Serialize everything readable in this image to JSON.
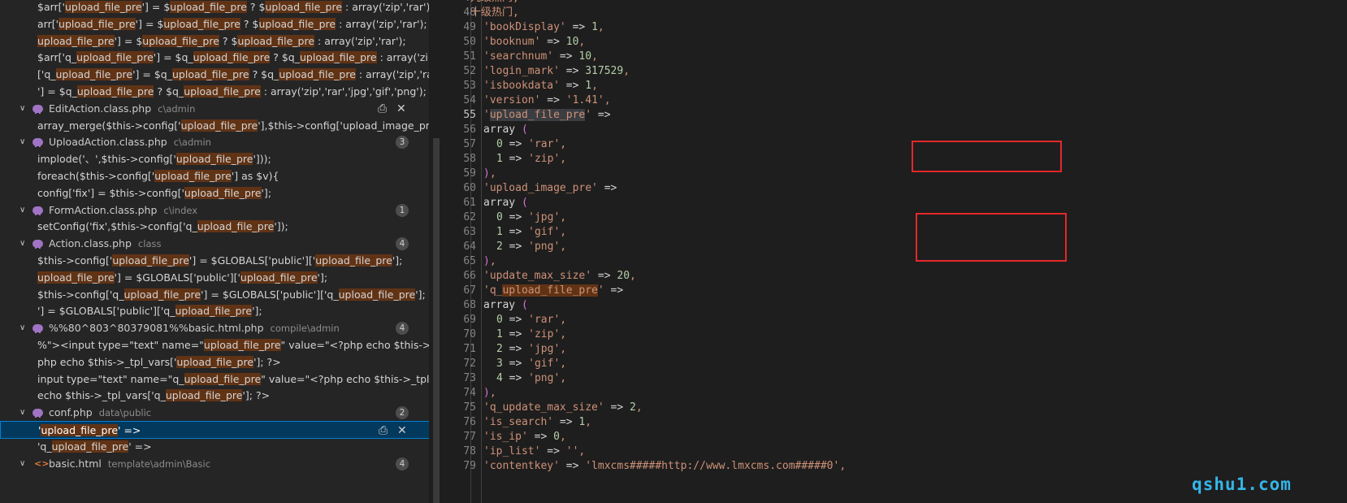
{
  "search_results": [
    {
      "type": "match",
      "text": "$arr['upload_file_pre'] = $upload_file_pre ? $upload_file_pre : array('zip','rar');"
    },
    {
      "type": "match",
      "text": "arr['upload_file_pre'] = $upload_file_pre ? $upload_file_pre : array('zip','rar');"
    },
    {
      "type": "match",
      "text": "upload_file_pre'] = $upload_file_pre ? $upload_file_pre : array('zip','rar');"
    },
    {
      "type": "match",
      "text": "$arr['q_upload_file_pre'] = $q_upload_file_pre ? $q_upload_file_pre : array('zip','rar','jp..."
    },
    {
      "type": "match",
      "text": "['q_upload_file_pre'] = $q_upload_file_pre ? $q_upload_file_pre : array('zip','rar','jpg','g..."
    },
    {
      "type": "match",
      "text": "'] = $q_upload_file_pre ? $q_upload_file_pre : array('zip','rar','jpg','gif','png');"
    },
    {
      "type": "file",
      "name": "EditAction.class.php",
      "path": "c\\admin",
      "badge": "",
      "icon": "php-icon"
    },
    {
      "type": "match",
      "text": "array_merge($this->config['upload_file_pre'],$this->config['upload_image_pre']);"
    },
    {
      "type": "file",
      "name": "UploadAction.class.php",
      "path": "c\\admin",
      "badge": "3",
      "icon": "php-icon"
    },
    {
      "type": "match",
      "text": "implode('、',$this->config['upload_file_pre']));"
    },
    {
      "type": "match",
      "text": "foreach($this->config['upload_file_pre'] as $v){"
    },
    {
      "type": "match",
      "text": "config['fix'] = $this->config['upload_file_pre'];"
    },
    {
      "type": "file",
      "name": "FormAction.class.php",
      "path": "c\\index",
      "badge": "1",
      "icon": "php-icon"
    },
    {
      "type": "match",
      "text": "setConfig('fix',$this->config['q_upload_file_pre']);"
    },
    {
      "type": "file",
      "name": "Action.class.php",
      "path": "class",
      "badge": "4",
      "icon": "php-icon"
    },
    {
      "type": "match",
      "text": "$this->config['upload_file_pre'] = $GLOBALS['public']['upload_file_pre'];"
    },
    {
      "type": "match",
      "text": "upload_file_pre'] = $GLOBALS['public']['upload_file_pre'];"
    },
    {
      "type": "match",
      "text": "$this->config['q_upload_file_pre'] = $GLOBALS['public']['q_upload_file_pre'];"
    },
    {
      "type": "match",
      "text": "'] = $GLOBALS['public']['q_upload_file_pre'];"
    },
    {
      "type": "file",
      "name": "%%80^803^80379081%%basic.html.php",
      "path": "compile\\admin",
      "badge": "4",
      "icon": "php-icon"
    },
    {
      "type": "match",
      "text": "%\">​<input type=\"text\" name=\"upload_file_pre\" value=\"<?php echo $this->_tpl_vars..."
    },
    {
      "type": "match",
      "text": "php echo $this->_tpl_vars['upload_file_pre']; ?>"
    },
    {
      "type": "match",
      "text": "input type=\"text\" name=\"q_upload_file_pre\" value=\"<?php echo $this->_tpl_vars['q_..."
    },
    {
      "type": "match",
      "text": "echo $this->_tpl_vars['q_upload_file_pre']; ?>"
    },
    {
      "type": "file",
      "name": "conf.php",
      "path": "data\\public",
      "badge": "2",
      "icon": "php-icon"
    },
    {
      "type": "match",
      "text": "'upload_file_pre' =>",
      "selected": true
    },
    {
      "type": "match",
      "text": "'q_upload_file_pre' =>"
    },
    {
      "type": "file",
      "name": "basic.html",
      "path": "template\\admin\\Basic",
      "badge": "4",
      "icon": "html-icon"
    }
  ],
  "code_lines": [
    {
      "n": "47",
      "t": "九级热门',"
    },
    {
      "n": "48",
      "t": "十级热门',"
    },
    {
      "n": "49",
      "t": "'bookDisplay' => 1,"
    },
    {
      "n": "50",
      "t": "'booknum' => 10,"
    },
    {
      "n": "51",
      "t": "'searchnum' => 10,"
    },
    {
      "n": "52",
      "t": "'login_mark' => 317529,"
    },
    {
      "n": "53",
      "t": "'isbookdata' => 1,"
    },
    {
      "n": "54",
      "t": "'version' => '1.41',"
    },
    {
      "n": "55",
      "t": "'upload_file_pre' =>"
    },
    {
      "n": "56",
      "t": "array ("
    },
    {
      "n": "57",
      "t": "0 => 'rar',"
    },
    {
      "n": "58",
      "t": "1 => 'zip',"
    },
    {
      "n": "59",
      "t": "),"
    },
    {
      "n": "60",
      "t": "'upload_image_pre' =>"
    },
    {
      "n": "61",
      "t": "array ("
    },
    {
      "n": "62",
      "t": "0 => 'jpg',"
    },
    {
      "n": "63",
      "t": "1 => 'gif',"
    },
    {
      "n": "64",
      "t": "2 => 'png',"
    },
    {
      "n": "65",
      "t": "),"
    },
    {
      "n": "66",
      "t": "'update_max_size' => 20,"
    },
    {
      "n": "67",
      "t": "'q_upload_file_pre' =>"
    },
    {
      "n": "68",
      "t": "array ("
    },
    {
      "n": "69",
      "t": "0 => 'rar',"
    },
    {
      "n": "70",
      "t": "1 => 'zip',"
    },
    {
      "n": "71",
      "t": "2 => 'jpg',"
    },
    {
      "n": "72",
      "t": "3 => 'gif',"
    },
    {
      "n": "73",
      "t": "4 => 'png',"
    },
    {
      "n": "74",
      "t": "),"
    },
    {
      "n": "75",
      "t": "'q_update_max_size' => 2,"
    },
    {
      "n": "76",
      "t": "'is_search' => 1,"
    },
    {
      "n": "77",
      "t": "'is_ip' => 0,"
    },
    {
      "n": "78",
      "t": "'ip_list' => '',"
    },
    {
      "n": "79",
      "t": "'contentkey' => 'lmxcms#####http://www.lmxcms.com#####0',"
    }
  ],
  "current_line": "55",
  "search_term": "upload_file_pre",
  "watermark": "qshu1.com",
  "colors": {
    "match_highlight": "#613315",
    "selection": "#04395e",
    "string": "#ce9178",
    "number": "#b5cea8",
    "annotation_box": "#e5282a",
    "watermark": "#35b5e8"
  }
}
